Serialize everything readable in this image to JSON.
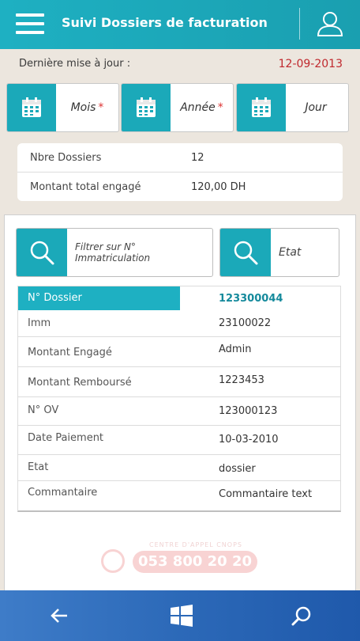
{
  "header": {
    "title": "Suivi Dossiers de facturation"
  },
  "update": {
    "label": "Dernière mise à jour :",
    "date": "12-09-2013"
  },
  "date_filters": [
    {
      "label": "Mois",
      "required": "*"
    },
    {
      "label": "Année",
      "required": "*"
    },
    {
      "label": "Jour",
      "required": ""
    }
  ],
  "summary": {
    "rows": [
      {
        "label": "Nbre Dossiers",
        "value": "12"
      },
      {
        "label": "Montant total engagé",
        "value": "120,00 DH"
      }
    ]
  },
  "filters": {
    "immatriculation_placeholder": "Filtrer sur N° Immatriculation",
    "etat_label": "Etat"
  },
  "dossier": {
    "header": {
      "label": "N° Dossier",
      "value": "123300044"
    },
    "rows": [
      {
        "label": "Imm",
        "value": "23100022"
      },
      {
        "label": "Montant Engagé",
        "value": "Admin"
      },
      {
        "label": "Montant Remboursé",
        "value": "1223453"
      },
      {
        "label": "N° OV",
        "value": "123000123"
      },
      {
        "label": "Date Paiement",
        "value": "10-03-2010"
      },
      {
        "label": "Etat",
        "value": "dossier"
      },
      {
        "label": "Commantaire",
        "value": "Commantaire text"
      }
    ]
  },
  "watermark": {
    "caption": "CENTRE D'APPEL CNOPS",
    "phone": "053 800 20 20"
  },
  "colors": {
    "accent": "#1eb0c2",
    "date_red": "#c0282d",
    "nav_blue": "#2c69b8"
  },
  "nav": {
    "icons": [
      "back-arrow-icon",
      "windows-logo-icon",
      "search-icon"
    ]
  }
}
